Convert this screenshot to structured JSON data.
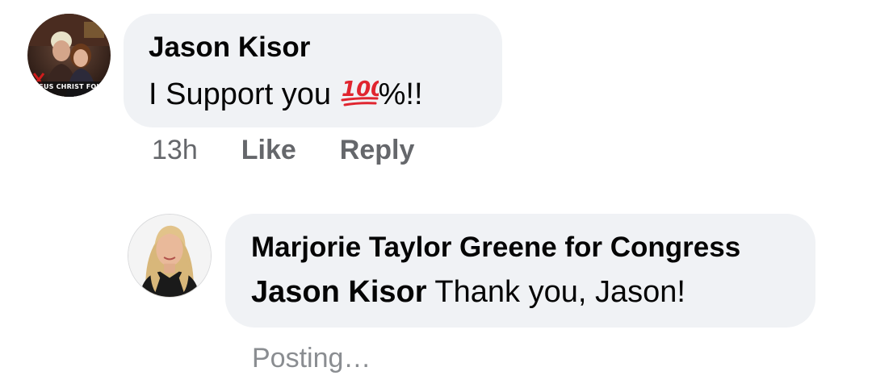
{
  "comments": [
    {
      "author": "Jason Kisor",
      "text_before": "I Support you ",
      "emoji": "100-emoji",
      "text_after": "%!!",
      "avatar": {
        "icon": "profile-photo-couple",
        "caption": "SUS CHRIST FOLL"
      },
      "actions": {
        "time": "13h",
        "like": "Like",
        "reply": "Reply"
      }
    },
    {
      "author": "Marjorie Taylor Greene for Congress",
      "mention": "Jason Kisor",
      "text": " Thank you, Jason!",
      "avatar": {
        "icon": "profile-photo-woman"
      },
      "status": "Posting…"
    }
  ],
  "colors": {
    "bubble": "#f0f2f5",
    "meta_text": "#65676b",
    "posting_text": "#8a8d91",
    "emoji_red": "#e0252f"
  }
}
